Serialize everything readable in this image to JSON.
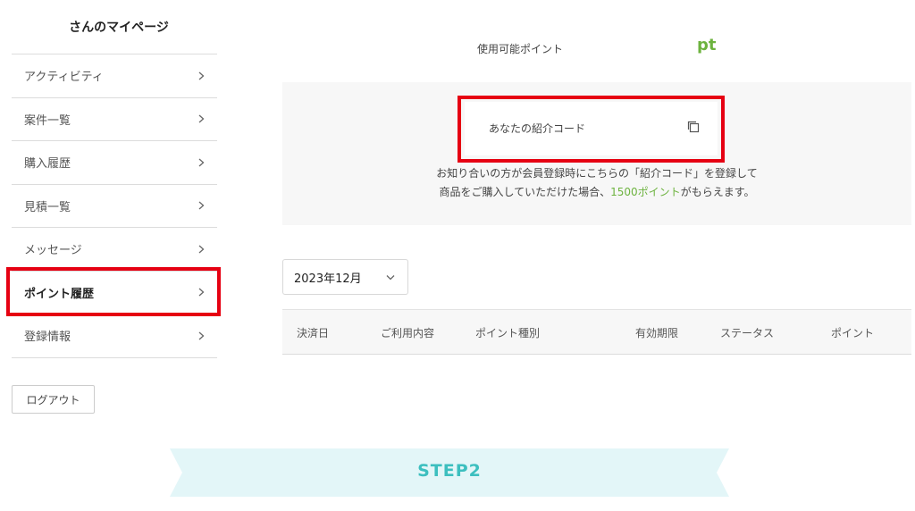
{
  "sidebar": {
    "user_title": "さんのマイページ",
    "items": [
      {
        "label": "アクティビティ"
      },
      {
        "label": "案件一覧"
      },
      {
        "label": "購入履歴"
      },
      {
        "label": "見積一覧"
      },
      {
        "label": "メッセージ"
      },
      {
        "label": "ポイント履歴",
        "active": true
      },
      {
        "label": "登録情報"
      }
    ],
    "logout_label": "ログアウト"
  },
  "points": {
    "label": "使用可能ポイント",
    "unit": "pt"
  },
  "referral": {
    "code_label": "あなたの紹介コード",
    "copy_icon": "copy-icon",
    "line1": "お知り合いの方が会員登録時にこちらの「紹介コード」を登録して",
    "line2_prefix": "商品をご購入していただけた場合、",
    "line2_highlight": "1500ポイント",
    "line2_suffix": "がもらえます。"
  },
  "history": {
    "selected_month": "2023年12月",
    "columns": [
      "決済日",
      "ご利用内容",
      "ポイント種別",
      "有効期限",
      "ステータス",
      "ポイント"
    ]
  },
  "step_banner": {
    "label": "STEP2"
  },
  "colors": {
    "accent_green": "#6db33f",
    "highlight_red": "#e60012",
    "step_teal": "#3cbfbf",
    "banner_bg": "#e3f6f8"
  }
}
